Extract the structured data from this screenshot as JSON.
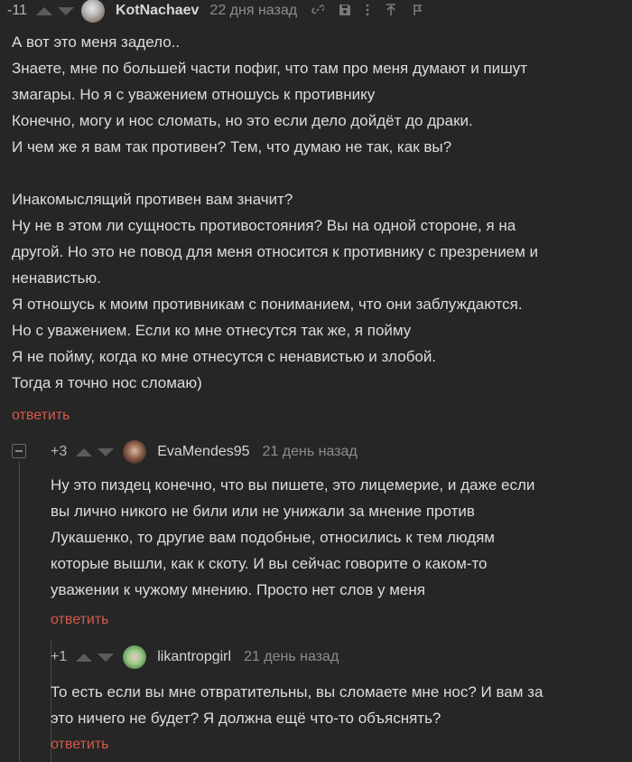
{
  "colors": {
    "background": "#262627",
    "text": "#dcdcdc",
    "reply": "#d65a48",
    "muted": "#8d8d8d"
  },
  "comments": [
    {
      "rating": "-11",
      "author": "KotNachaev",
      "date": "22 дня назад",
      "icons": [
        "link-icon",
        "save-icon",
        "more-icon",
        "scroll-up-icon",
        "bookmark-icon"
      ],
      "lines": [
        "А вот это меня задело..",
        "Знаете, мне по большей части пофиг, что там про меня думают и пишут",
        "змагары. Но я с уважением отношусь к противнику",
        "Конечно, могу и нос сломать, но это если дело дойдёт до драки.",
        "И чем же я вам так противен? Тем, что думаю не так, как вы?",
        "",
        "Инакомыслящий противен вам значит?",
        "Ну не в этом ли сущность противостояния? Вы на одной стороне, я на",
        "другой. Но это не повод для меня относится к противнику с презрением и",
        "ненавистью.",
        "Я отношусь к моим противникам с пониманием, что они заблуждаются.",
        "Но с уважением. Если ко мне отнесутся так же, я пойму",
        "Я не пойму, когда ко мне отнесутся с ненавистью и злобой.",
        "Тогда я точно нос сломаю)"
      ],
      "reply": "ответить"
    },
    {
      "rating": "+3",
      "author": "EvaMendes95",
      "date": "21 день назад",
      "lines": [
        "Ну это пиздец конечно, что вы пишете, это лицемерие, и даже если",
        "вы лично никого не били или не унижали за мнение против",
        "Лукашенко, то другие вам подобные, относились к тем людям",
        "которые вышли, как к скоту. И вы сейчас говорите о каком-то",
        "уважении к чужому мнению. Просто нет слов у меня"
      ],
      "reply": "ответить"
    },
    {
      "rating": "+1",
      "author": "likantropgirl",
      "date": "21 день назад",
      "lines": [
        "То есть если вы мне отвратительны, вы сломаете мне нос? И вам за",
        "это ничего не будет? Я должна ещё что-то объяснять?"
      ],
      "reply": "ответить"
    }
  ]
}
